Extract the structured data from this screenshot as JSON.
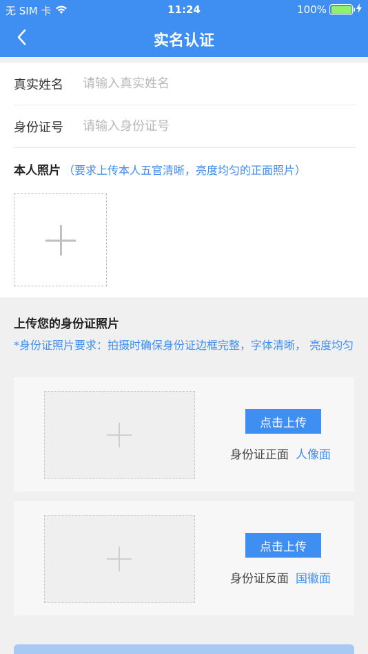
{
  "status_bar": {
    "carrier": "无 SIM 卡",
    "wifi_icon": "wifi-icon",
    "time": "11:24",
    "battery_percent": "100%",
    "battery_level": 1.0,
    "charging_icon": "bolt-icon"
  },
  "nav": {
    "back_icon": "chevron-left-icon",
    "title": "实名认证"
  },
  "form": {
    "name_label": "真实姓名",
    "name_placeholder": "请输入真实姓名",
    "name_value": "",
    "id_label": "身份证号",
    "id_placeholder": "请输入身份证号",
    "id_value": ""
  },
  "photo": {
    "label": "本人照片",
    "hint": "（要求上传本人五官清晰，亮度均匀的正面照片）"
  },
  "id_section": {
    "title": "上传您的身份证照片",
    "requirement": "*身份证照片要求：拍摄时确保身份证边框完整，字体清晰， 亮度均匀",
    "cards": [
      {
        "button": "点击上传",
        "desc": "身份证正面",
        "side": "人像面"
      },
      {
        "button": "点击上传",
        "desc": "身份证反面",
        "side": "国徽面"
      }
    ]
  },
  "colors": {
    "primary": "#3f8ef2",
    "submit_disabled": "#a8c9f3",
    "background": "#f0f0f0"
  }
}
